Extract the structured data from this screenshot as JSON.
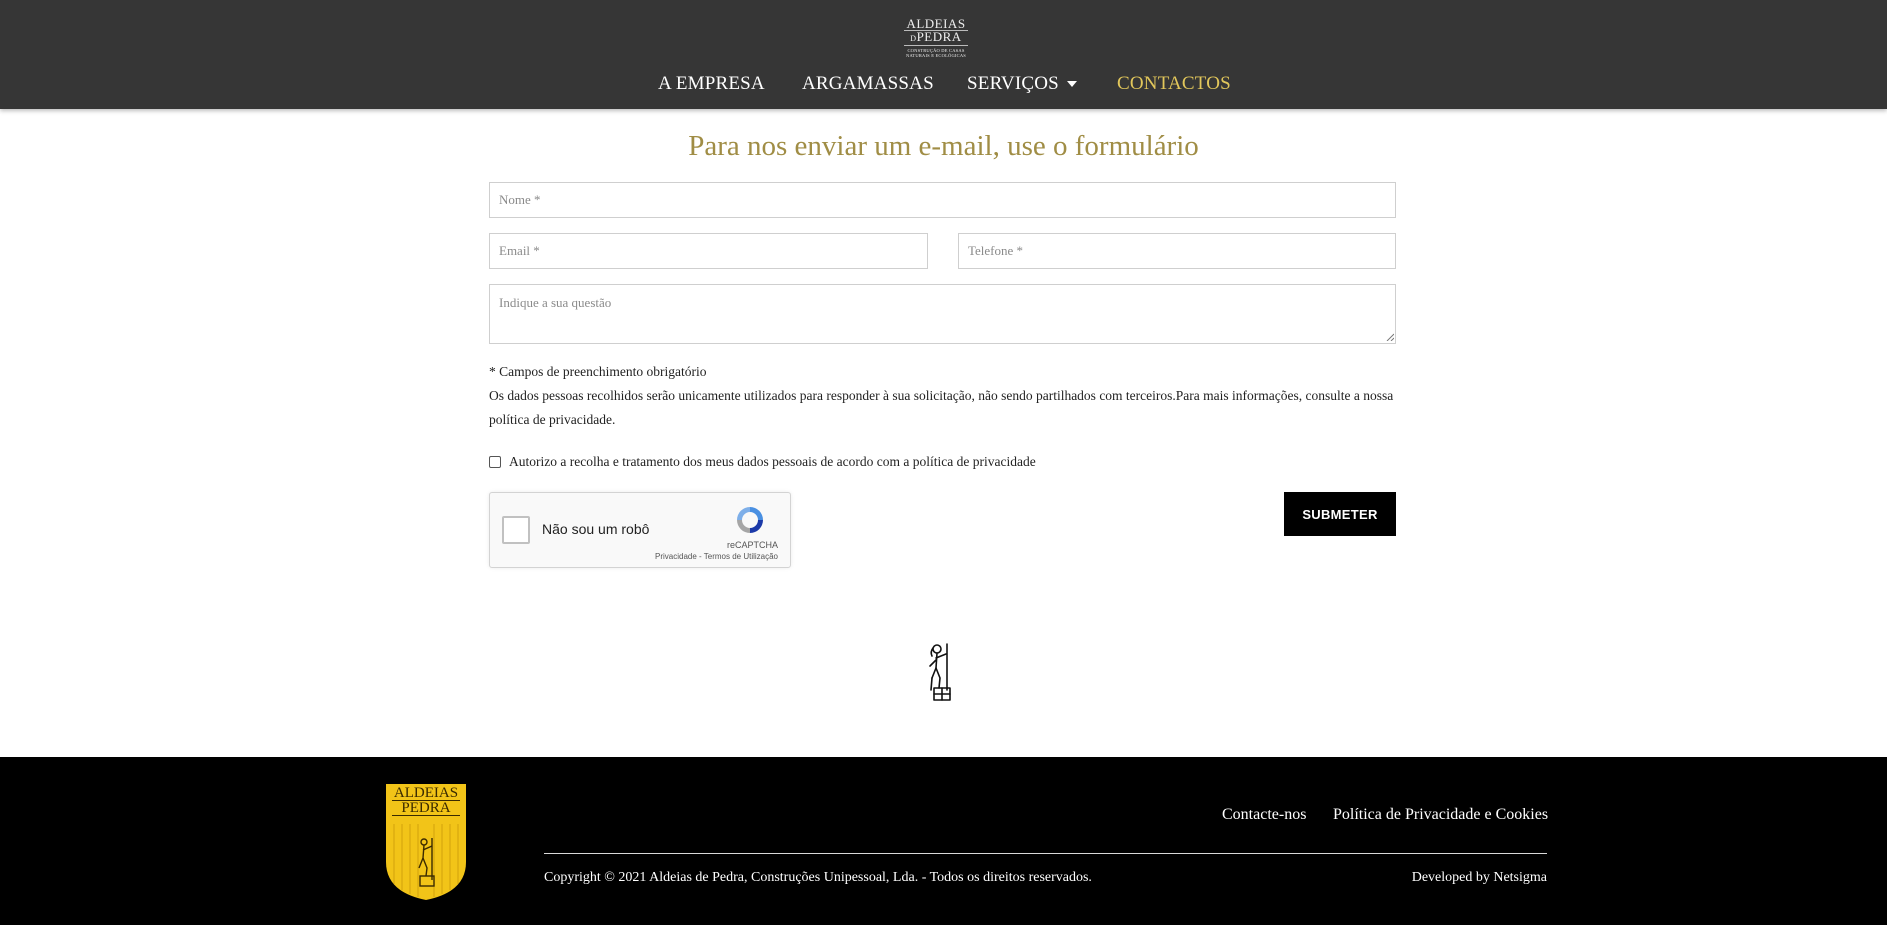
{
  "header": {
    "logo": {
      "line1": "ALDEIAS",
      "line2": "PEDRA",
      "line3": "CONSTRUÇÃO DE CASAS NATURAIS E ECOLÓGICAS",
      "small_d": "D"
    },
    "nav": [
      {
        "label": "A EMPRESA"
      },
      {
        "label": "ARGAMASSAS"
      },
      {
        "label": "SERVIÇOS"
      },
      {
        "label": "CONTACTOS"
      }
    ]
  },
  "form": {
    "title": "Para nos enviar um e-mail, use o formulário",
    "name_placeholder": "Nome *",
    "email_placeholder": "Email *",
    "phone_placeholder": "Telefone *",
    "message_placeholder": "Indique a sua questão",
    "required_note": "* Campos de preenchimento obrigatório",
    "privacy_note": "Os dados pessoas recolhidos serão unicamente utilizados para responder à sua solicitação, não sendo partilhados com terceiros.Para mais informações, consulte a nossa política de privacidade.",
    "consent_label": "Autorizo a recolha e tratamento dos meus dados pessoais de acordo com a política de privacidade",
    "submit_label": "SUBMETER"
  },
  "captcha": {
    "label": "Não sou um robô",
    "brand": "reCAPTCHA",
    "terms": "Privacidade - Termos de Utilização"
  },
  "footer": {
    "logo": {
      "line1": "ALDEIAS",
      "line2": "PEDRA"
    },
    "links": [
      {
        "label": "Contacte-nos"
      },
      {
        "label": "Política de Privacidade e Cookies"
      }
    ],
    "copyright": "Copyright © 2021 Aldeias de Pedra, Construções Unipessoal, Lda. - Todos os direitos reservados.",
    "developer": "Developed by Netsigma"
  },
  "colors": {
    "header_bg": "#363636",
    "accent_gold": "#a08d45",
    "nav_active": "#e2c75b",
    "footer_bg": "#000000",
    "shield_yellow": "#f2c418"
  }
}
